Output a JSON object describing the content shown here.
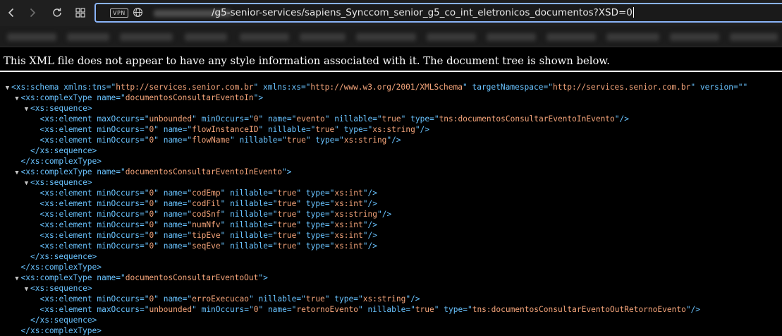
{
  "browser": {
    "url_host_hidden": true,
    "url_path": "/g5-senior-services/sapiens_Synccom_senior_g5_co_int_eletronicos_documentos?XSD=0",
    "vpn_label": "VPN",
    "accent_color": "#8ab4f8"
  },
  "icons": [
    "back-icon",
    "forward-icon",
    "reload-icon",
    "tab-grid-icon",
    "globe-icon",
    "collapse-arrow-icon"
  ],
  "notice": {
    "text": "This XML file does not appear to have any style information associated with it. The document tree is shown below."
  },
  "xml": {
    "colors": {
      "tag": "#69c3ff",
      "value": "#f4a47a",
      "text": "#ffffff"
    },
    "schema": {
      "tag": "xs:schema",
      "attrs": [
        {
          "name": "xmlns:tns",
          "value": "http://services.senior.com.br"
        },
        {
          "name": "xmlns:xs",
          "value": "http://www.w3.org/2001/XMLSchema"
        },
        {
          "name": "targetNamespace",
          "value": "http://services.senior.com.br"
        },
        {
          "name": "version",
          "value": ""
        }
      ],
      "complexTypes": [
        {
          "name": "documentosConsultarEventoIn",
          "elements": [
            [
              {
                "name": "maxOccurs",
                "value": "unbounded"
              },
              {
                "name": "minOccurs",
                "value": "0"
              },
              {
                "name": "name",
                "value": "evento"
              },
              {
                "name": "nillable",
                "value": "true"
              },
              {
                "name": "type",
                "value": "tns:documentosConsultarEventoInEvento"
              }
            ],
            [
              {
                "name": "minOccurs",
                "value": "0"
              },
              {
                "name": "name",
                "value": "flowInstanceID"
              },
              {
                "name": "nillable",
                "value": "true"
              },
              {
                "name": "type",
                "value": "xs:string"
              }
            ],
            [
              {
                "name": "minOccurs",
                "value": "0"
              },
              {
                "name": "name",
                "value": "flowName"
              },
              {
                "name": "nillable",
                "value": "true"
              },
              {
                "name": "type",
                "value": "xs:string"
              }
            ]
          ]
        },
        {
          "name": "documentosConsultarEventoInEvento",
          "elements": [
            [
              {
                "name": "minOccurs",
                "value": "0"
              },
              {
                "name": "name",
                "value": "codEmp"
              },
              {
                "name": "nillable",
                "value": "true"
              },
              {
                "name": "type",
                "value": "xs:int"
              }
            ],
            [
              {
                "name": "minOccurs",
                "value": "0"
              },
              {
                "name": "name",
                "value": "codFil"
              },
              {
                "name": "nillable",
                "value": "true"
              },
              {
                "name": "type",
                "value": "xs:int"
              }
            ],
            [
              {
                "name": "minOccurs",
                "value": "0"
              },
              {
                "name": "name",
                "value": "codSnf"
              },
              {
                "name": "nillable",
                "value": "true"
              },
              {
                "name": "type",
                "value": "xs:string"
              }
            ],
            [
              {
                "name": "minOccurs",
                "value": "0"
              },
              {
                "name": "name",
                "value": "numNfv"
              },
              {
                "name": "nillable",
                "value": "true"
              },
              {
                "name": "type",
                "value": "xs:int"
              }
            ],
            [
              {
                "name": "minOccurs",
                "value": "0"
              },
              {
                "name": "name",
                "value": "tipEve"
              },
              {
                "name": "nillable",
                "value": "true"
              },
              {
                "name": "type",
                "value": "xs:int"
              }
            ],
            [
              {
                "name": "minOccurs",
                "value": "0"
              },
              {
                "name": "name",
                "value": "seqEve"
              },
              {
                "name": "nillable",
                "value": "true"
              },
              {
                "name": "type",
                "value": "xs:int"
              }
            ]
          ]
        },
        {
          "name": "documentosConsultarEventoOut",
          "elements": [
            [
              {
                "name": "minOccurs",
                "value": "0"
              },
              {
                "name": "name",
                "value": "erroExecucao"
              },
              {
                "name": "nillable",
                "value": "true"
              },
              {
                "name": "type",
                "value": "xs:string"
              }
            ],
            [
              {
                "name": "maxOccurs",
                "value": "unbounded"
              },
              {
                "name": "minOccurs",
                "value": "0"
              },
              {
                "name": "name",
                "value": "retornoEvento"
              },
              {
                "name": "nillable",
                "value": "true"
              },
              {
                "name": "type",
                "value": "tns:documentosConsultarEventoOutRetornoEvento"
              }
            ]
          ]
        }
      ]
    }
  }
}
